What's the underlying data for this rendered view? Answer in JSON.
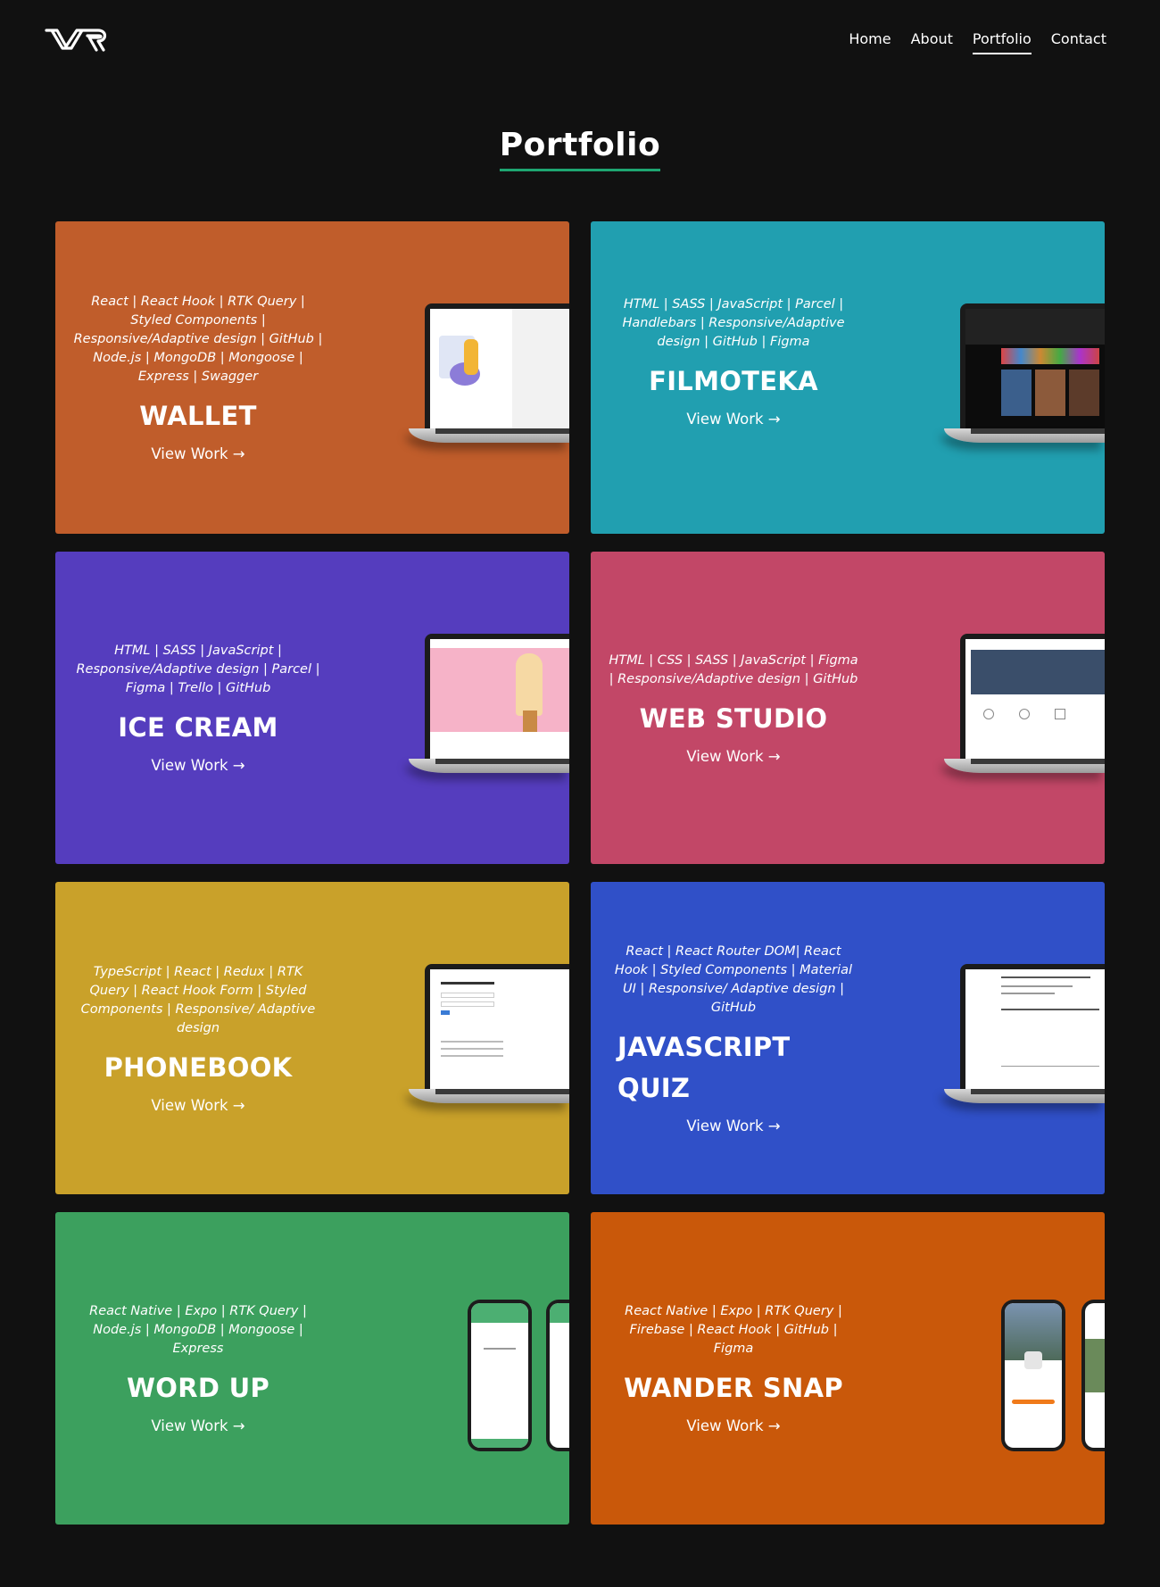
{
  "header": {
    "logo_text": "VR",
    "nav": [
      {
        "label": "Home",
        "active": false
      },
      {
        "label": "About",
        "active": false
      },
      {
        "label": "Portfolio",
        "active": true
      },
      {
        "label": "Contact",
        "active": false
      }
    ]
  },
  "page": {
    "title": "Portfolio"
  },
  "projects": [
    {
      "title": "WALLET",
      "color": "#c05d2b",
      "tech": "React | React Hook | RTK Query | Styled Components | Responsive/Adaptive design | GitHub | Node.js | MongoDB | Mongoose | Express | Swagger",
      "link": "View Work →",
      "screen": "wallet-app-screenshot"
    },
    {
      "title": "FILMOTEKA",
      "color": "#219fb0",
      "tech": "HTML | SASS | JavaScript | Parcel | Handlebars | Responsive/Adaptive design | GitHub | Figma",
      "link": "View Work →",
      "screen": "filmoteka-app-screenshot"
    },
    {
      "title": "ICE CREAM",
      "color": "#553dbe",
      "tech": "HTML | SASS | JavaScript | Responsive/Adaptive design | Parcel | Figma | Trello | GitHub",
      "link": "View Work →",
      "screen": "ice-cream-site-screenshot"
    },
    {
      "title": "WEB STUDIO",
      "color": "#c24767",
      "tech": "HTML | CSS | SASS | JavaScript | Figma | Responsive/Adaptive design | GitHub",
      "link": "View Work →",
      "screen": "web-studio-site-screenshot"
    },
    {
      "title": "PHONEBOOK",
      "color": "#c9a12a",
      "tech": "TypeScript | React | Redux | RTK Query | React Hook Form | Styled Components | Responsive/ Adaptive design",
      "link": "View Work →",
      "screen": "phonebook-app-screenshot"
    },
    {
      "title": "JAVASCRIPT QUIZ",
      "color": "#3050c8",
      "tech": "React | React Router DOM| React Hook | Styled Components | Material UI | Responsive/ Adaptive design | GitHub",
      "link": "View Work →",
      "screen": "javascript-quiz-screenshot"
    },
    {
      "title": "WORD UP",
      "color": "#3ca05e",
      "tech": "React Native | Expo | RTK Query | Node.js | MongoDB | Mongoose | Express",
      "link": "View Work →",
      "screen": "word-up-mobile-screenshot"
    },
    {
      "title": "WANDER SNAP",
      "color": "#c9580a",
      "tech": "React Native | Expo | RTK Query | Firebase | React Hook | GitHub | Figma",
      "link": "View Work →",
      "screen": "wander-snap-mobile-screenshot"
    }
  ]
}
